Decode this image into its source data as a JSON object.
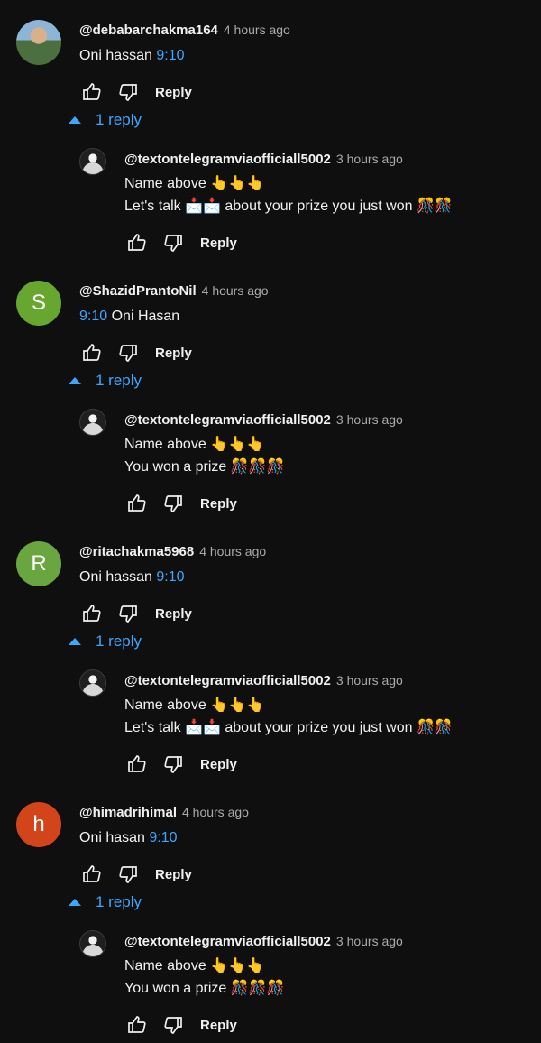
{
  "threads": [
    {
      "comment": {
        "avatar_type": "photo",
        "avatar_color": "#7ea7c8",
        "author": "@debabarchakma164",
        "time": "4 hours ago",
        "text_prefix": "Oni hassan",
        "timestamp": "9:10",
        "text_suffix": "",
        "reply_label": "Reply"
      },
      "toggle_label": "1 reply",
      "reply": {
        "author": "@textontelegramviaofficiall5002",
        "time": "3 hours ago",
        "line1": "Name above 👆👆👆",
        "line2": "Let's talk 📩📩 about your prize you just won 🎊🎊",
        "reply_label": "Reply"
      }
    },
    {
      "comment": {
        "avatar_letter": "S",
        "avatar_color": "#67a62f",
        "author": "@ShazidPrantoNil",
        "time": "4 hours ago",
        "text_prefix": "",
        "timestamp": "9:10",
        "text_suffix": "Oni Hasan",
        "reply_label": "Reply"
      },
      "toggle_label": "1 reply",
      "reply": {
        "author": "@textontelegramviaofficiall5002",
        "time": "3 hours ago",
        "line1": "Name above 👆👆👆",
        "line2": "You won a prize 🎊🎊🎊",
        "reply_label": "Reply"
      }
    },
    {
      "comment": {
        "avatar_letter": "R",
        "avatar_color": "#6aa640",
        "author": "@ritachakma5968",
        "time": "4 hours ago",
        "text_prefix": "Oni hassan",
        "timestamp": "9:10",
        "text_suffix": "",
        "reply_label": "Reply"
      },
      "toggle_label": "1 reply",
      "reply": {
        "author": "@textontelegramviaofficiall5002",
        "time": "3 hours ago",
        "line1": "Name above 👆👆👆",
        "line2": "Let's talk 📩📩 about your prize you just won 🎊🎊",
        "reply_label": "Reply"
      }
    },
    {
      "comment": {
        "avatar_letter": "h",
        "avatar_color": "#d2451a",
        "author": "@himadrihimal",
        "time": "4 hours ago",
        "text_prefix": "Oni hasan",
        "timestamp": "9:10",
        "text_suffix": "",
        "reply_label": "Reply"
      },
      "toggle_label": "1 reply",
      "reply": {
        "author": "@textontelegramviaofficiall5002",
        "time": "3 hours ago",
        "line1": "Name above 👆👆👆",
        "line2": "You won a prize 🎊🎊🎊",
        "reply_label": "Reply"
      }
    }
  ],
  "icons": {
    "like": "thumbs-up-icon",
    "dislike": "thumbs-down-icon",
    "collapse": "caret-up-icon"
  },
  "colors": {
    "background": "#0f0f0f",
    "link": "#3ea6ff",
    "muted": "#aaaaaa",
    "text": "#f1f1f1"
  }
}
